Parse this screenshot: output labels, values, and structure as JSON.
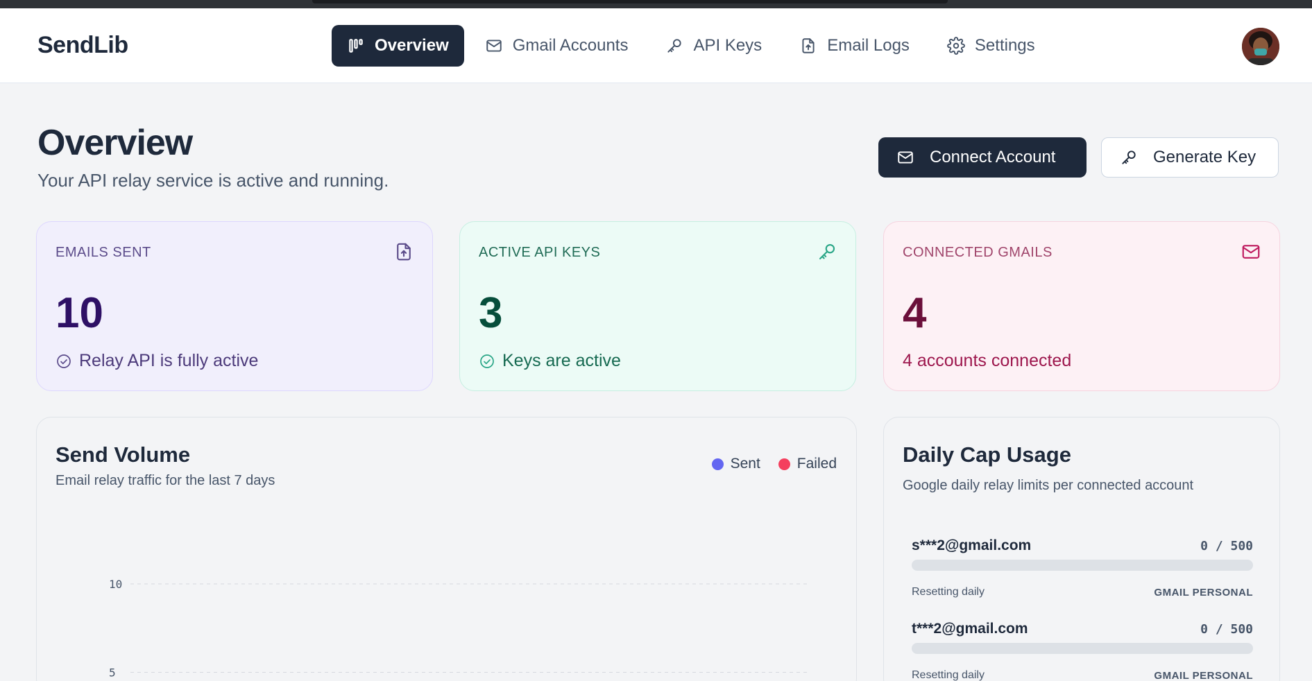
{
  "app": {
    "brand": "SendLib"
  },
  "nav": {
    "items": [
      {
        "label": "Overview",
        "icon": "chart-bars-icon",
        "active": true
      },
      {
        "label": "Gmail Accounts",
        "icon": "mail-icon",
        "active": false
      },
      {
        "label": "API Keys",
        "icon": "key-icon",
        "active": false
      },
      {
        "label": "Email Logs",
        "icon": "file-upload-icon",
        "active": false
      },
      {
        "label": "Settings",
        "icon": "gear-icon",
        "active": false
      }
    ]
  },
  "header": {
    "title": "Overview",
    "subtitle": "Your API relay service is active and running.",
    "connect_label": "Connect Account",
    "generate_label": "Generate Key"
  },
  "stats": [
    {
      "label": "EMAILS SENT",
      "value": "10",
      "footer": "Relay API is fully active",
      "icon": "file-upload-icon",
      "color": "#5b4b8a"
    },
    {
      "label": "ACTIVE API KEYS",
      "value": "3",
      "footer": "Keys are active",
      "icon": "key-icon",
      "color": "#1f6b55"
    },
    {
      "label": "CONNECTED GMAILS",
      "value": "4",
      "footer": "4 accounts connected",
      "icon": "mail-icon",
      "color": "#a0456b"
    }
  ],
  "send_volume": {
    "title": "Send Volume",
    "subtitle": "Email relay traffic for the last 7 days",
    "legend": [
      {
        "name": "Sent",
        "color": "#6366f1"
      },
      {
        "name": "Failed",
        "color": "#f43f5e"
      }
    ]
  },
  "chart_data": {
    "type": "line",
    "series": [
      {
        "name": "Sent",
        "color": "#6366f1"
      },
      {
        "name": "Failed",
        "color": "#f43f5e"
      }
    ],
    "yticks": [
      10,
      5
    ],
    "grid": true,
    "legend": "top-right"
  },
  "daily_cap": {
    "title": "Daily Cap Usage",
    "subtitle": "Google daily relay limits per connected account",
    "accounts": [
      {
        "email": "s***2@gmail.com",
        "count": "0 / 500",
        "used": 0,
        "note": "Resetting daily",
        "type": "GMAIL PERSONAL"
      },
      {
        "email": "t***2@gmail.com",
        "count": "0 / 500",
        "used": 0,
        "note": "Resetting daily",
        "type": "GMAIL PERSONAL"
      }
    ]
  }
}
